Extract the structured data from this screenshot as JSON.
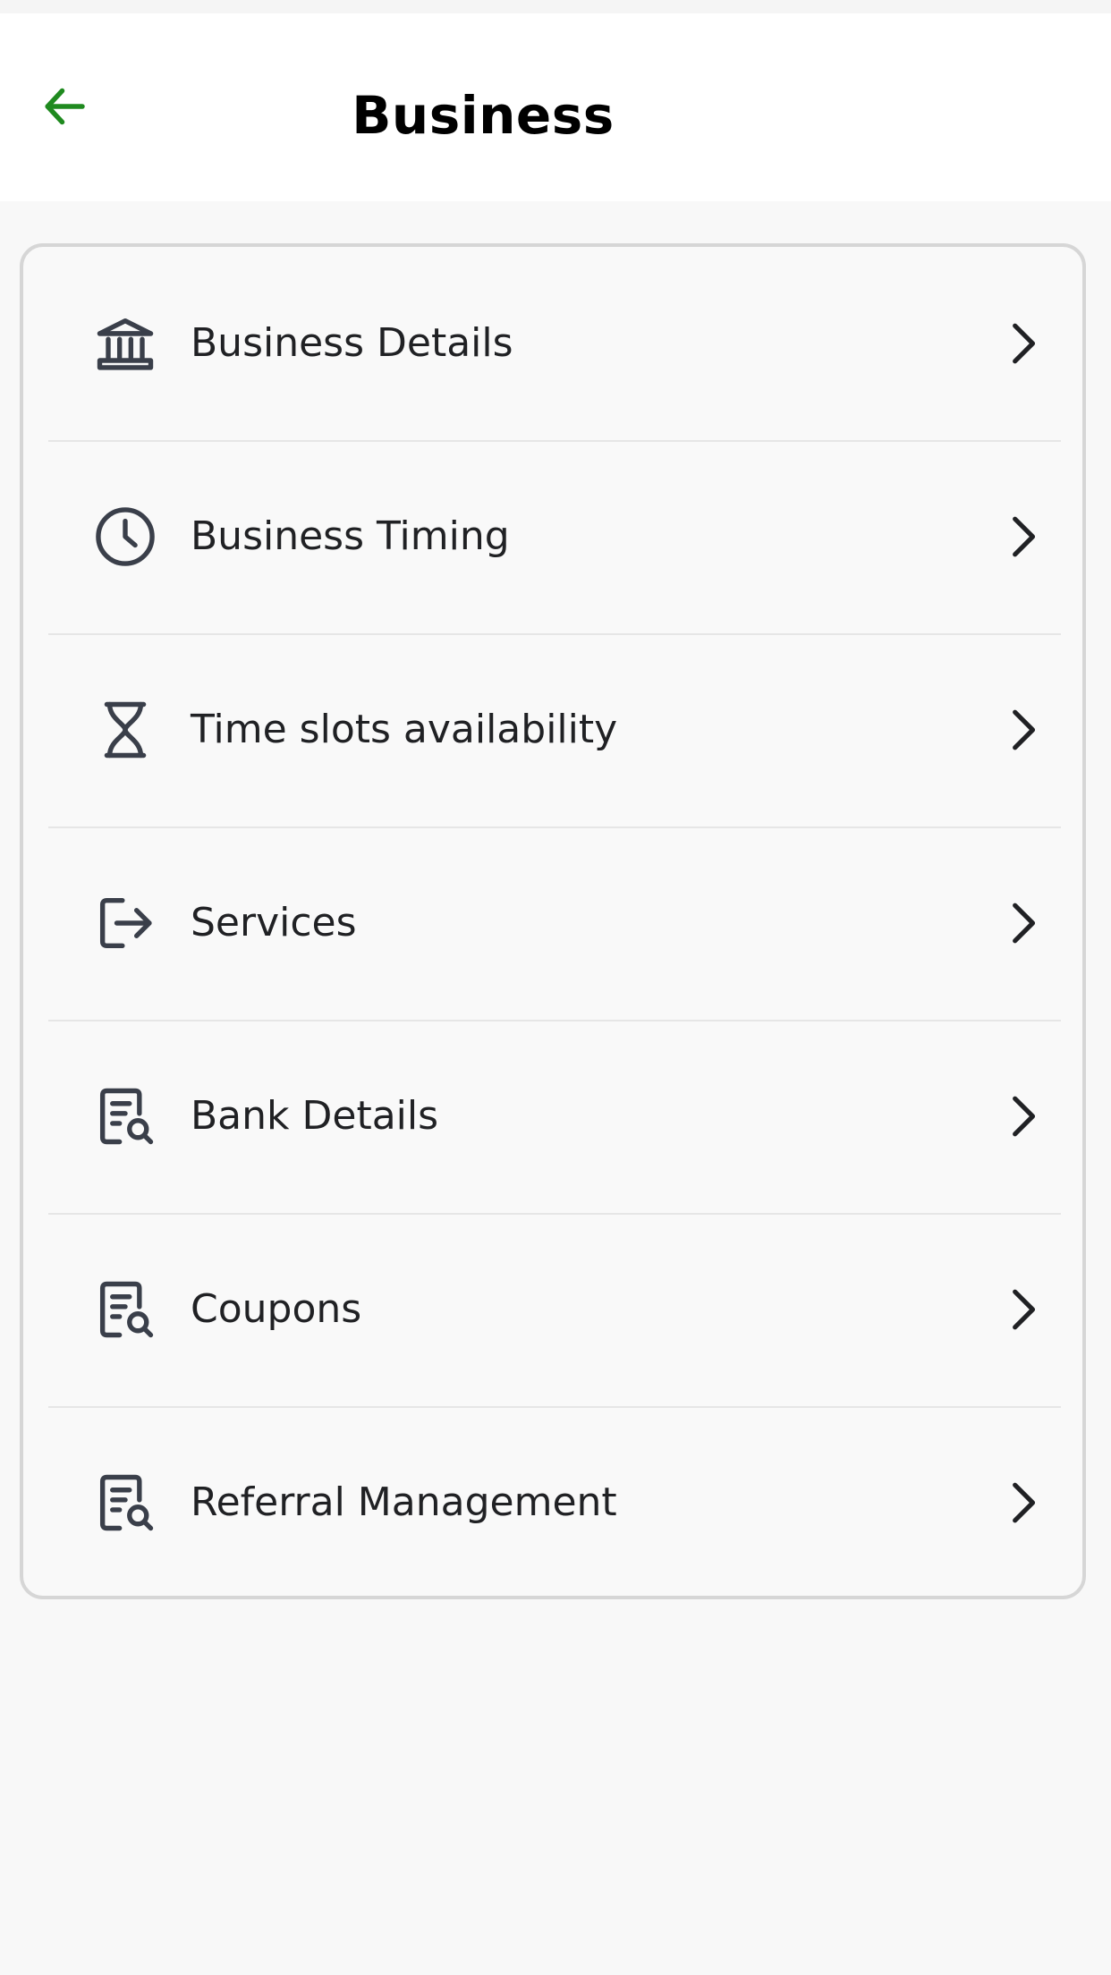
{
  "header": {
    "title": "Business",
    "back_icon": "arrow-left-icon",
    "back_icon_color": "#1f8a1f"
  },
  "menu": {
    "items": [
      {
        "label": "Business Details",
        "icon": "bank-icon"
      },
      {
        "label": "Business Timing",
        "icon": "clock-icon"
      },
      {
        "label": "Time slots availability",
        "icon": "hourglass-icon"
      },
      {
        "label": "Services",
        "icon": "logout-arrow-icon"
      },
      {
        "label": "Bank Details",
        "icon": "document-search-icon"
      },
      {
        "label": "Coupons",
        "icon": "document-search-icon"
      },
      {
        "label": "Referral Management",
        "icon": "document-search-icon"
      }
    ],
    "chevron_icon": "chevron-right-icon",
    "icon_color": "#3a3f4a"
  }
}
